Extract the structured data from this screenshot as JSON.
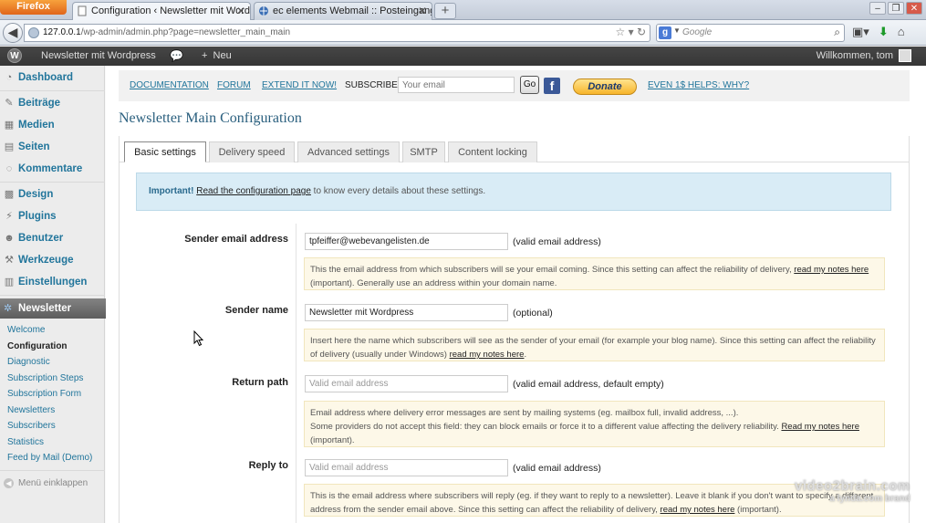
{
  "browser": {
    "menu_button": "Firefox",
    "tabs": [
      {
        "title": "Configuration ‹ Newsletter mit Word..."
      },
      {
        "title": "ec elements Webmail :: Posteingang"
      }
    ],
    "new_tab": "+",
    "url_host": "127.0.0.1",
    "url_path": "/wp-admin/admin.php?page=newsletter_main_main",
    "search_placeholder": "Google"
  },
  "adminbar": {
    "site_name": "Newsletter mit Wordpress",
    "new_label": "Neu",
    "welcome": "Willkommen, tom"
  },
  "sidebar": {
    "items": [
      {
        "label": "Dashboard",
        "icon": "dashboard-icon"
      },
      {
        "label": "Beiträge",
        "icon": "pin-icon"
      },
      {
        "label": "Medien",
        "icon": "media-icon"
      },
      {
        "label": "Seiten",
        "icon": "pages-icon"
      },
      {
        "label": "Kommentare",
        "icon": "comments-icon"
      },
      {
        "label": "Design",
        "icon": "appearance-icon"
      },
      {
        "label": "Plugins",
        "icon": "plugins-icon"
      },
      {
        "label": "Benutzer",
        "icon": "users-icon"
      },
      {
        "label": "Werkzeuge",
        "icon": "tools-icon"
      },
      {
        "label": "Einstellungen",
        "icon": "settings-icon"
      }
    ],
    "newsletter": "Newsletter",
    "subitems": [
      "Welcome",
      "Configuration",
      "Diagnostic",
      "Subscription Steps",
      "Subscription Form",
      "Newsletters",
      "Subscribers",
      "Statistics",
      "Feed by Mail (Demo)"
    ],
    "current_subitem": "Configuration",
    "collapse": "Menü einklappen"
  },
  "toplinks": {
    "documentation": "DOCUMENTATION",
    "forum": "FORUM",
    "extend": "EXTEND IT NOW!",
    "subscribe": "SUBSCRIBE",
    "email_placeholder": "Your email",
    "go": "Go",
    "donate": "Donate",
    "even": "EVEN 1$ HELPS: WHY?"
  },
  "page": {
    "title": "Newsletter Main Configuration",
    "tabs": [
      "Basic settings",
      "Delivery speed",
      "Advanced settings",
      "SMTP",
      "Content locking"
    ],
    "active_tab": "Basic settings"
  },
  "info": {
    "important": "Important!",
    "link": "Read the configuration page",
    "rest": "to know every details about these settings."
  },
  "fields": {
    "sender_email": {
      "label": "Sender email address",
      "value": "tpfeiffer@webevangelisten.de",
      "hint": "(valid email address)",
      "desc": "This the email address from which subscribers will se your email coming. Since this setting can affect the reliability of delivery,",
      "desc_link": "read my notes here",
      "desc_end": "(important). Generally use an address within your domain name."
    },
    "sender_name": {
      "label": "Sender name",
      "value": "Newsletter mit Wordpress",
      "hint": "(optional)",
      "desc": "Insert here the name which subscribers will see as the sender of your email (for example your blog name). Since this setting can affect the reliability of delivery (usually under Windows)",
      "desc_link": "read my notes here",
      "desc_end": "."
    },
    "return_path": {
      "label": "Return path",
      "placeholder": "Valid email address",
      "hint": "(valid email address, default empty)",
      "desc1": "Email address where delivery error messages are sent by mailing systems (eg. mailbox full, invalid address, ...).",
      "desc2": "Some providers do not accept this field: they can block emails or force it to a different value affecting the delivery reliability.",
      "desc_link": "Read my notes here",
      "desc_end": "(important)."
    },
    "reply_to": {
      "label": "Reply to",
      "placeholder": "Valid email address",
      "hint": "(valid email address)",
      "desc": "This is the email address where subscribers will reply (eg. if they want to reply to a newsletter). Leave it blank if you don't want to specify a different address from the sender email above. Since this setting can affect the reliability of delivery,",
      "desc_link": "read my notes here",
      "desc_end": "(important)."
    }
  },
  "watermark": {
    "line1": "video2brain.com",
    "line2": "a lynda.com brand"
  }
}
